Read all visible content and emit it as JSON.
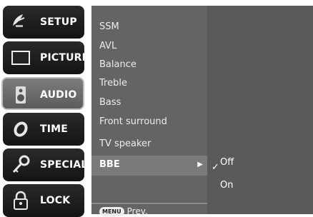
{
  "left_menu": [
    {
      "label": "SETUP",
      "icon": "satellite-dish-icon",
      "active": false
    },
    {
      "label": "PICTURE",
      "icon": "screen-icon",
      "active": false
    },
    {
      "label": "AUDIO",
      "icon": "speaker-icon",
      "active": true
    },
    {
      "label": "TIME",
      "icon": "clock-icon",
      "active": false
    },
    {
      "label": "SPECIAL",
      "icon": "key-icon",
      "active": false
    },
    {
      "label": "LOCK",
      "icon": "padlock-icon",
      "active": false
    }
  ],
  "submenu": {
    "items": [
      "SSM",
      "AVL",
      "Balance",
      "Treble",
      "Bass",
      "Front surround",
      "TV speaker"
    ],
    "selected": "BBE",
    "footer": {
      "key": "MENU",
      "label": "Prev."
    }
  },
  "options": {
    "check": "✓",
    "items": [
      "Off",
      "On"
    ],
    "selected": "Off"
  }
}
